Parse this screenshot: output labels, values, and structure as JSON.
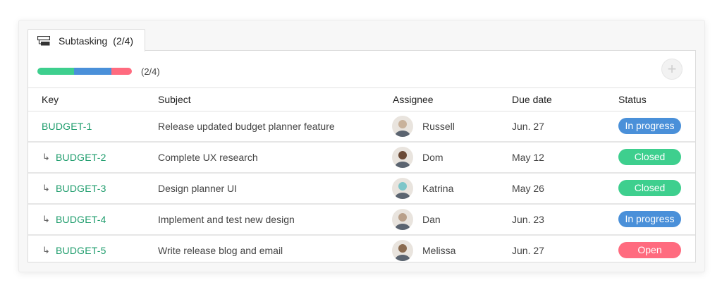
{
  "tab": {
    "label": "Subtasking",
    "count": "(2/4)",
    "icon": "subtask-icon"
  },
  "progress": {
    "text": "(2/4)",
    "segments": [
      {
        "name": "closed",
        "fraction": 0.39,
        "color": "#3ecf8e"
      },
      {
        "name": "in-progress",
        "fraction": 0.39,
        "color": "#4a90d9"
      },
      {
        "name": "open",
        "fraction": 0.22,
        "color": "#ff6b7f"
      }
    ]
  },
  "add_button": {
    "icon": "plus-icon",
    "label": "+"
  },
  "columns": {
    "key": "Key",
    "subject": "Subject",
    "assignee": "Assignee",
    "due": "Due date",
    "status": "Status"
  },
  "status_colors": {
    "In progress": "#4a90d9",
    "Closed": "#3ecf8e",
    "Open": "#ff6b7f"
  },
  "rows": [
    {
      "key": "BUDGET-1",
      "sub": false,
      "subject": "Release updated budget planner feature",
      "assignee": "Russell",
      "avatar_color": "#c9b29b",
      "due": "Jun. 27",
      "status": "In progress"
    },
    {
      "key": "BUDGET-2",
      "sub": true,
      "subject": "Complete UX research",
      "assignee": "Dom",
      "avatar_color": "#6b4a36",
      "due": "May 12",
      "status": "Closed"
    },
    {
      "key": "BUDGET-3",
      "sub": true,
      "subject": "Design planner UI",
      "assignee": "Katrina",
      "avatar_color": "#7ec6c9",
      "due": "May 26",
      "status": "Closed"
    },
    {
      "key": "BUDGET-4",
      "sub": true,
      "subject": "Implement and test new design",
      "assignee": "Dan",
      "avatar_color": "#b9a08a",
      "due": "Jun. 23",
      "status": "In progress"
    },
    {
      "key": "BUDGET-5",
      "sub": true,
      "subject": "Write release blog and email",
      "assignee": "Melissa",
      "avatar_color": "#8a6a4f",
      "due": "Jun. 27",
      "status": "Open"
    }
  ]
}
